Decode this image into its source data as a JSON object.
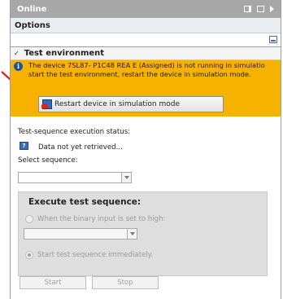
{
  "titlebar": {
    "title": "Online"
  },
  "options": {
    "label": "Options"
  },
  "section": {
    "title": "Test environment"
  },
  "warning": {
    "line1": "The device 7SL87- P1C48 REA E (Assigned) is not running in simulatio",
    "line2": "start the test environment, restart the device in simulation mode.",
    "button_label": "Restart device in simulation mode"
  },
  "status": {
    "label": "Test-sequence execution status:",
    "value": "Data not yet retrieved..."
  },
  "sequence": {
    "label": "Select sequence:",
    "selected": ""
  },
  "execute": {
    "title": "Execute test sequence:",
    "option_binary": "When the binary input is set to high:",
    "binary_selected": "",
    "option_immediate": "Start test sequence immediately."
  },
  "buttons": {
    "start": "Start",
    "stop": "Stop"
  },
  "colors": {
    "warning_bg": "#f7b200",
    "accent_arrow": "#e02020"
  }
}
